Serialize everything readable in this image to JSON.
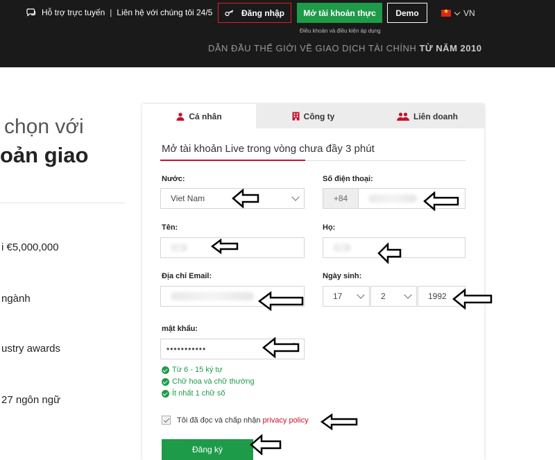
{
  "header": {
    "support_label": "Hỗ trợ trực tuyến",
    "separator": "|",
    "contact_label": "Liên hệ với chúng tôi 24/5",
    "login_label": "Đăng nhập",
    "open_account_label": "Mở tài khoản thực",
    "demo_label": "Demo",
    "language": "VN",
    "terms_label": "Điều khoản và điều kiện áp dụng",
    "tagline_main": "DẪN ĐẦU THẾ GIỚI VỀ GIAO DỊCH TÀI CHÍNH",
    "tagline_bold": "TỪ NĂM 2010"
  },
  "promo": {
    "line1": "chọn với",
    "line2": "oản giao",
    "features": [
      "i €5,000,000",
      "ngành",
      "ustry awards",
      "27 ngôn ngữ"
    ]
  },
  "tabs": [
    {
      "label": "Cá nhân",
      "icon": "person-icon",
      "active": true
    },
    {
      "label": "Công ty",
      "icon": "building-icon",
      "active": false
    },
    {
      "label": "Liên doanh",
      "icon": "users-icon",
      "active": false
    }
  ],
  "form": {
    "title": "Mở tài khoản Live trong vòng chưa đầy 3 phút",
    "country_label": "Nước:",
    "country_value": "Viet Nam",
    "phone_label": "Số điện thoại:",
    "phone_prefix": "+84",
    "first_name_label": "Tên:",
    "last_name_label": "Họ:",
    "email_label": "Địa chỉ Email:",
    "dob_label": "Ngày sinh:",
    "dob_day": "17",
    "dob_month": "2",
    "dob_year": "1992",
    "password_label": "mật khẩu:",
    "password_value": "•••••••••••",
    "rules": [
      "Từ 6 - 15 ký tự",
      "Chữ hoa và chữ thường",
      "Ít nhất 1 chữ số"
    ],
    "agree_text": "Tôi đã đọc và chấp nhận",
    "agree_link": "privacy policy",
    "agree_checked": true,
    "submit_label": "Đăng ký"
  },
  "colors": {
    "header_bg": "#1a1a1a",
    "accent_green": "#1e9b49",
    "accent_red": "#c8102e"
  }
}
